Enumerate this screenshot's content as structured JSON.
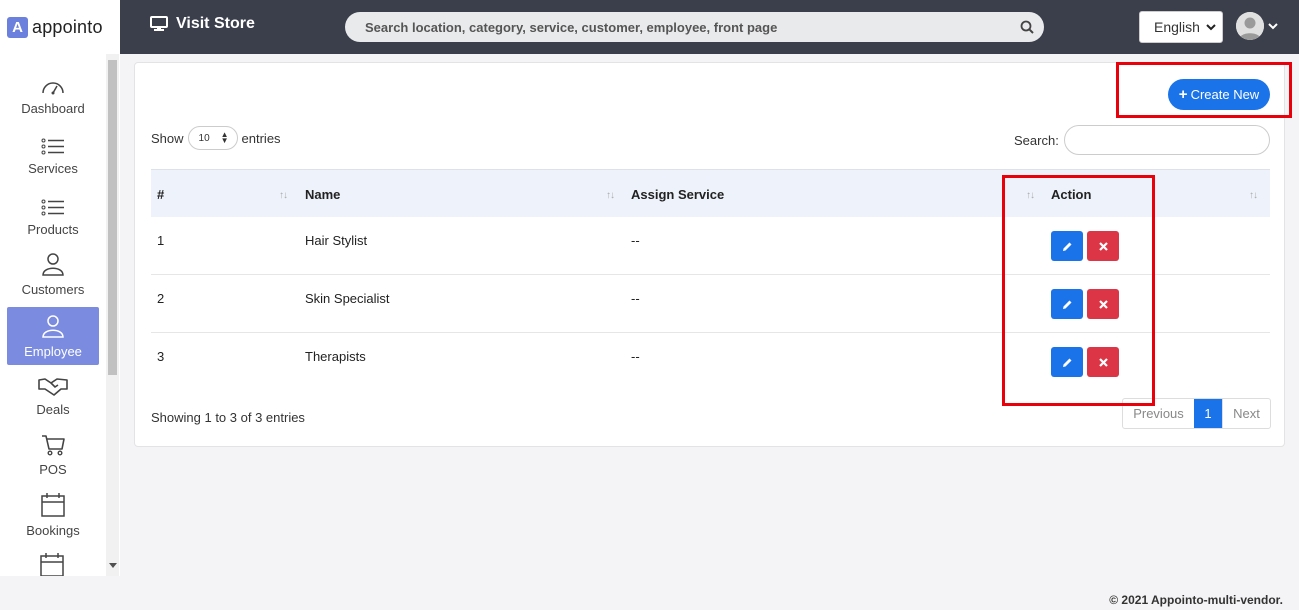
{
  "brand": {
    "logo_letter": "A",
    "name": "appointo"
  },
  "topbar": {
    "visit_store": "Visit Store",
    "search_placeholder": "Search location, category, service, customer, employee, front page",
    "language": "English"
  },
  "sidebar": {
    "items": [
      {
        "label": "Dashboard",
        "icon": "gauge-icon",
        "active": false
      },
      {
        "label": "Services",
        "icon": "list-icon",
        "active": false
      },
      {
        "label": "Products",
        "icon": "list-icon",
        "active": false
      },
      {
        "label": "Customers",
        "icon": "user-icon",
        "active": false
      },
      {
        "label": "Employee",
        "icon": "user-icon",
        "active": true
      },
      {
        "label": "Deals",
        "icon": "handshake-icon",
        "active": false
      },
      {
        "label": "POS",
        "icon": "cart-icon",
        "active": false
      },
      {
        "label": "Bookings",
        "icon": "calendar-icon",
        "active": false
      }
    ]
  },
  "content": {
    "create_button": "Create New",
    "show_label": "Show",
    "page_length": "10",
    "entries_label": "entries",
    "search_label": "Search:",
    "columns": [
      "#",
      "Name",
      "Assign Service",
      "Action"
    ],
    "rows": [
      {
        "num": "1",
        "name": "Hair Stylist",
        "service": "--"
      },
      {
        "num": "2",
        "name": "Skin Specialist",
        "service": "--"
      },
      {
        "num": "3",
        "name": "Therapists",
        "service": "--"
      }
    ],
    "info": "Showing 1 to 3 of 3 entries",
    "pagination": {
      "previous": "Previous",
      "current": "1",
      "next": "Next"
    }
  },
  "footer": {
    "copyright": "© 2021 Appointo-multi-vendor."
  },
  "colors": {
    "topbar": "#3a3f4b",
    "accent": "#1a73e8",
    "danger": "#dc3545",
    "sidebar_active": "#7b8ce0",
    "highlight": "#e8000b"
  }
}
